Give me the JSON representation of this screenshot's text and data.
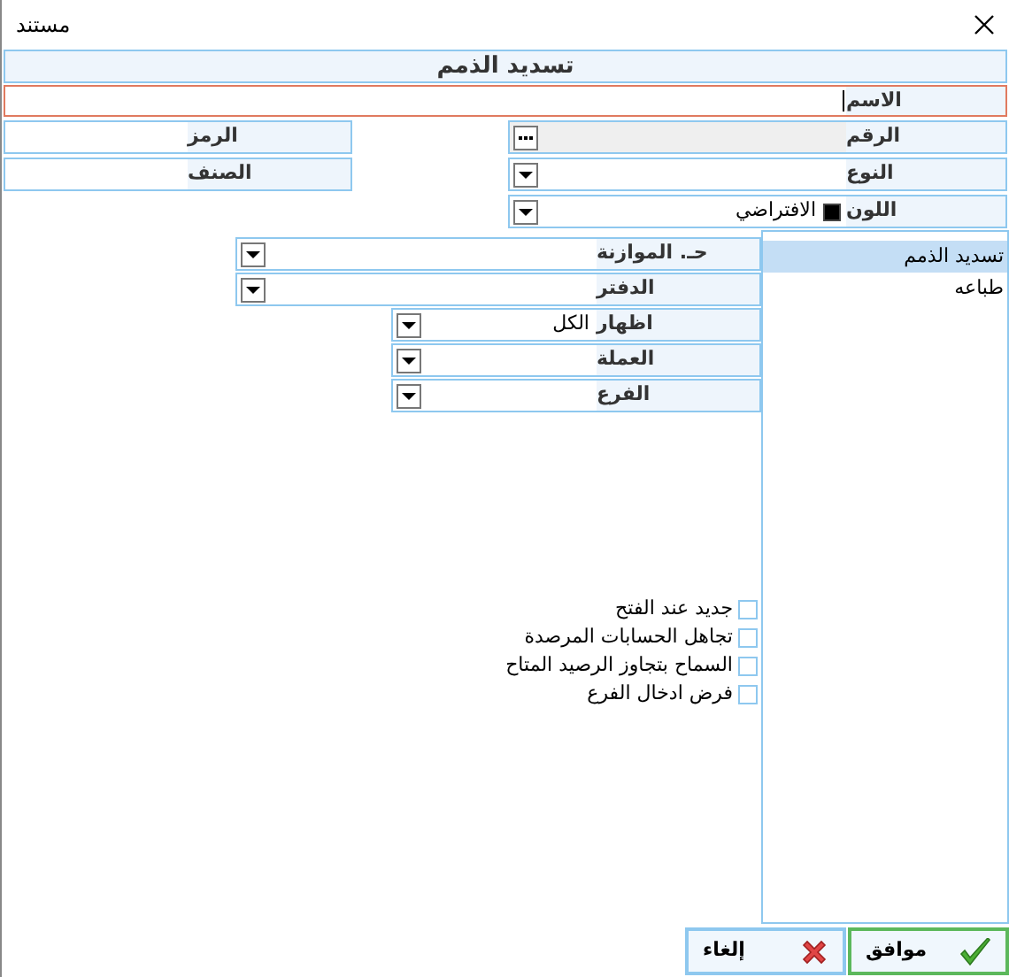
{
  "window": {
    "title": "مستند"
  },
  "header": "تسديد الذمم",
  "name_field": {
    "label": "الاسم",
    "focused": true
  },
  "fields_right": [
    {
      "label": "الرقم",
      "kind": "lookup",
      "disabled": true
    },
    {
      "label": "النوع",
      "kind": "combo",
      "disabled": false
    },
    {
      "label": "اللون",
      "kind": "color",
      "value": "الافتراضي",
      "color": "#000000",
      "disabled": false
    }
  ],
  "fields_left": [
    {
      "label": "الرمز"
    },
    {
      "label": "الصنف"
    }
  ],
  "sidebar": {
    "items": [
      {
        "label": "تسديد الذمم",
        "selected": true
      },
      {
        "label": "طباعه",
        "selected": false
      }
    ]
  },
  "options": [
    {
      "label": "حـ. الموازنة",
      "kind": "wide"
    },
    {
      "label": "الدفتر",
      "kind": "wide"
    },
    {
      "label": "اظهار",
      "kind": "narrow",
      "value": "الكل"
    },
    {
      "label": "العملة",
      "kind": "narrow"
    },
    {
      "label": "الفرع",
      "kind": "narrow"
    }
  ],
  "checkboxes": [
    {
      "label": "جديد عند الفتح",
      "checked": false
    },
    {
      "label": "تجاهل الحسابات المرصدة",
      "checked": false
    },
    {
      "label": "السماح بتجاوز الرصيد المتاح",
      "checked": false
    },
    {
      "label": "فرض ادخال الفرع",
      "checked": false
    }
  ],
  "buttons": [
    {
      "label": "موافق",
      "kind": "ok"
    },
    {
      "label": "إلغاء",
      "kind": "cancel"
    }
  ]
}
